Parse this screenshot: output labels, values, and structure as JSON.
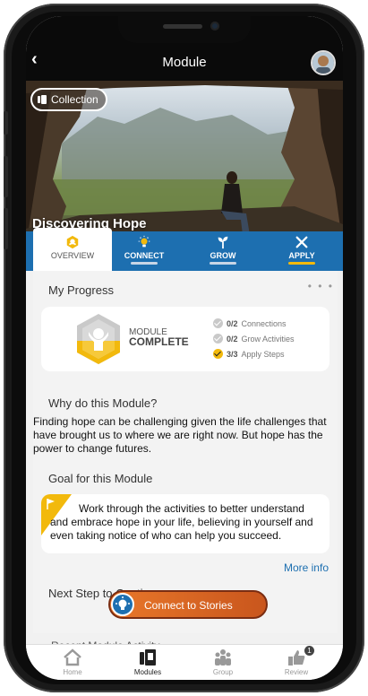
{
  "header": {
    "title": "Module",
    "back_icon": "chevron-left-icon"
  },
  "hero": {
    "collection_label": "Collection",
    "title": "Discovering Hope"
  },
  "tabs": [
    {
      "label": "OVERVIEW",
      "icon": "module-icon",
      "active": true
    },
    {
      "label": "CONNECT",
      "icon": "lightbulb-icon"
    },
    {
      "label": "GROW",
      "icon": "sprout-icon"
    },
    {
      "label": "APPLY",
      "icon": "tools-icon"
    }
  ],
  "progress": {
    "title": "My Progress",
    "module_label": "MODULE",
    "complete_label": "COMPLETE",
    "stats": [
      {
        "count": "0/2",
        "label": "Connections",
        "checked": false
      },
      {
        "count": "0/2",
        "label": "Grow Activities",
        "checked": false
      },
      {
        "count": "3/3",
        "label": "Apply Steps",
        "checked": true
      }
    ]
  },
  "why": {
    "title": "Why do this Module?",
    "text": "Finding hope can be challenging given the life challenges that have brought us to where we are right now. But hope has the power to change futures."
  },
  "goal": {
    "title": "Goal for this Module",
    "text": "Work through the activities to better understand and embrace hope in your life, believing in yourself and even taking notice of who can help you succeed.",
    "more_info": "More info"
  },
  "next_step": {
    "title": "Next Step to Continue",
    "button_label": "Connect to Stories"
  },
  "recent": {
    "title": "Recent Module Activity"
  },
  "nav": [
    {
      "label": "Home",
      "icon": "home-icon"
    },
    {
      "label": "Modules",
      "icon": "modules-icon",
      "active": true
    },
    {
      "label": "Group",
      "icon": "group-icon"
    },
    {
      "label": "Review",
      "icon": "thumbs-up-icon",
      "badge": "1"
    }
  ],
  "colors": {
    "accent_blue": "#1d6fb0",
    "accent_yellow": "#f2b90c",
    "cta_orange": "#e8772a"
  }
}
